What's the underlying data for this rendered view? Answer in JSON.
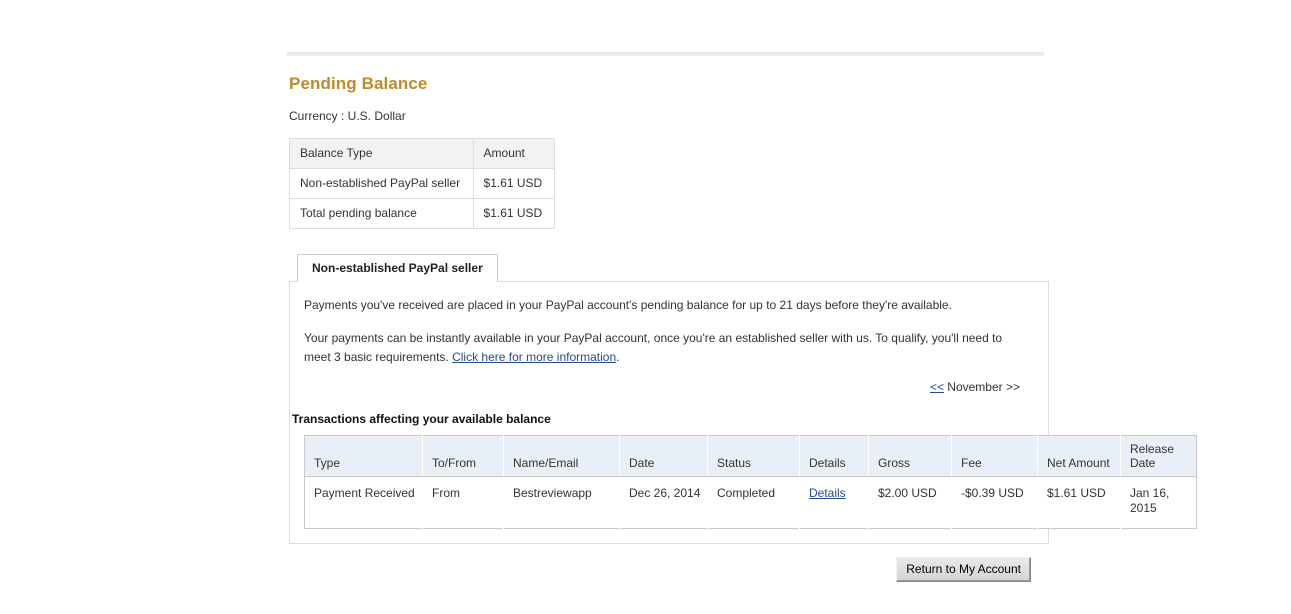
{
  "page": {
    "title": "Pending Balance",
    "currency_line": "Currency : U.S. Dollar"
  },
  "balance_table": {
    "headers": [
      "Balance Type",
      "Amount"
    ],
    "rows": [
      {
        "type": "Non-established PayPal seller",
        "amount": "$1.61 USD"
      },
      {
        "type": "Total pending balance",
        "amount": "$1.61 USD"
      }
    ]
  },
  "tab": {
    "label": "Non-established PayPal seller"
  },
  "panel": {
    "paragraph1": "Payments you've received are placed in your PayPal account's pending balance for up to 21 days before they're available.",
    "paragraph2_before": "Your payments can be instantly available in your PayPal account, once you're an established seller with us. To qualify, you'll need to meet 3 basic requirements. ",
    "paragraph2_link": "Click here for more information",
    "paragraph2_after": "."
  },
  "month_nav": {
    "prev": "<<",
    "label": " November ",
    "next": ">>"
  },
  "transactions": {
    "heading": "Transactions affecting your available balance",
    "headers": [
      "Type",
      "To/From",
      "Name/Email",
      "Date",
      "Status",
      "Details",
      "Gross",
      "Fee",
      "Net Amount",
      "Release Date"
    ],
    "rows": [
      {
        "type": "Payment Received",
        "to_from": "From",
        "name_email": "Bestreviewapp",
        "date": "Dec 26, 2014",
        "status": "Completed",
        "details": "Details",
        "gross": "$2.00 USD",
        "fee": "-$0.39 USD",
        "net_amount": "$1.61 USD",
        "release_date": "Jan 16, 2015"
      }
    ]
  },
  "footer": {
    "return_button": "Return to My Account"
  }
}
